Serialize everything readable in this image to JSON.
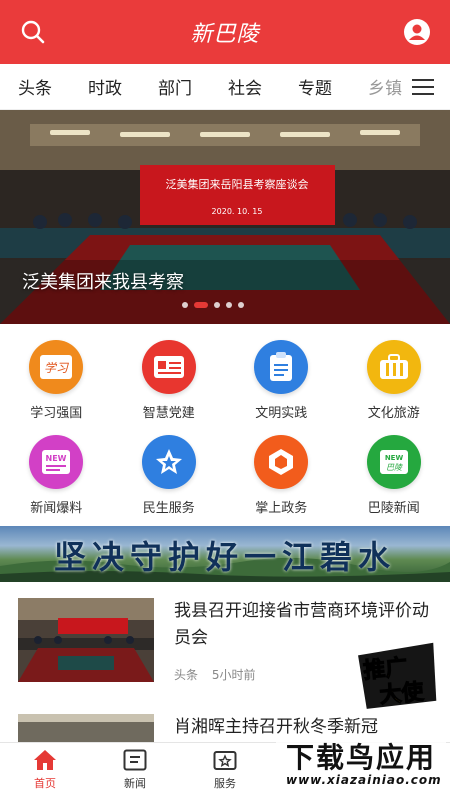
{
  "header": {
    "app_name": "新巴陵",
    "brand_color": "#ea3b3b"
  },
  "tabs": [
    "头条",
    "时政",
    "部门",
    "社会",
    "专题",
    "乡镇"
  ],
  "banner": {
    "sign_text": "泛美集团来岳阳县考察座谈会",
    "sign_date": "2020. 10. 15",
    "caption": "泛美集团来我县考察",
    "slide_count": 5,
    "active_slide": 2
  },
  "grid": [
    {
      "label": "学习强国",
      "icon": "study-icon",
      "color": "#f08a1c"
    },
    {
      "label": "智慧党建",
      "icon": "party-card-icon",
      "color": "#e8362f"
    },
    {
      "label": "文明实践",
      "icon": "clipboard-icon",
      "color": "#2f7fe0"
    },
    {
      "label": "文化旅游",
      "icon": "suitcase-icon",
      "color": "#f2b70f"
    },
    {
      "label": "新闻爆料",
      "icon": "news-new-icon",
      "color": "#d240c6"
    },
    {
      "label": "民生服务",
      "icon": "star-icon",
      "color": "#2f7fe0"
    },
    {
      "label": "掌上政务",
      "icon": "hexagon-icon",
      "color": "#f25c1c"
    },
    {
      "label": "巴陵新闻",
      "icon": "news-new-green-icon",
      "color": "#25a83f"
    }
  ],
  "slogan": "坚决守护好一江碧水",
  "news": [
    {
      "title": "我县召开迎接省市营商环境评价动员会",
      "tag": "头条",
      "time": "5小时前"
    },
    {
      "title": "肖湘晖主持召开秋冬季新冠",
      "tag": "",
      "time": ""
    }
  ],
  "promo": {
    "line1": "推广",
    "line2": "大使"
  },
  "nav": [
    {
      "label": "首页",
      "icon": "home-icon",
      "active": true
    },
    {
      "label": "新闻",
      "icon": "news-icon",
      "active": false
    },
    {
      "label": "服务",
      "icon": "service-icon",
      "active": false
    }
  ],
  "watermark": {
    "title": "下载鸟应用",
    "url": "www.xiazainiao.com"
  }
}
